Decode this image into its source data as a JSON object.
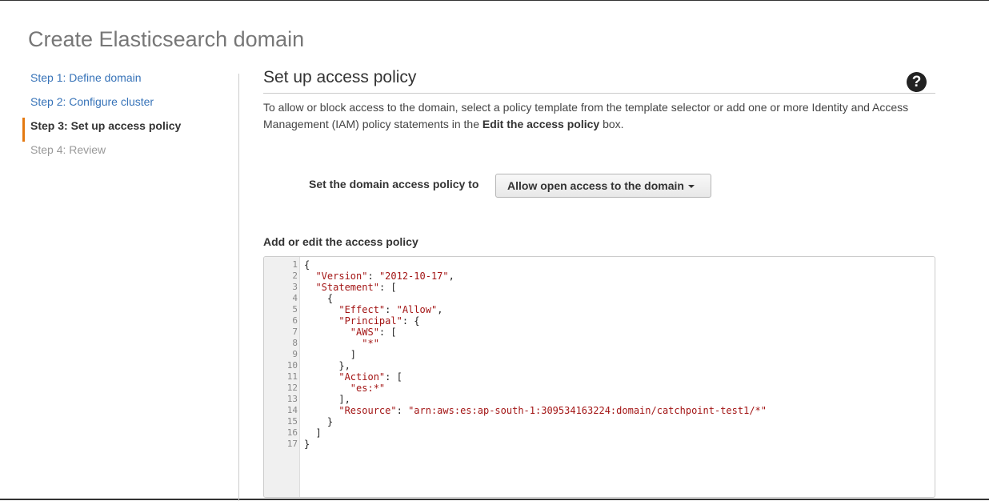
{
  "page_title": "Create Elasticsearch domain",
  "steps": [
    {
      "label": "Step 1: Define domain",
      "state": "link"
    },
    {
      "label": "Step 2: Configure cluster",
      "state": "link"
    },
    {
      "label": "Step 3: Set up access policy",
      "state": "active"
    },
    {
      "label": "Step 4: Review",
      "state": "disabled"
    }
  ],
  "section": {
    "title": "Set up access policy",
    "help_icon": "question-circle-icon",
    "description_part1": "To allow or block access to the domain, select a policy template from the template selector or add one or more Identity and Access Management (IAM) policy statements in the ",
    "description_bold": "Edit the access policy",
    "description_part2": " box."
  },
  "policy_selector": {
    "label": "Set the domain access policy to",
    "value": "Allow open access to the domain"
  },
  "editor": {
    "label": "Add or edit the access policy",
    "lines": [
      "{",
      "  \"Version\": \"2012-10-17\",",
      "  \"Statement\": [",
      "    {",
      "      \"Effect\": \"Allow\",",
      "      \"Principal\": {",
      "        \"AWS\": [",
      "          \"*\"",
      "        ]",
      "      },",
      "      \"Action\": [",
      "        \"es:*\"",
      "      ],",
      "      \"Resource\": \"arn:aws:es:ap-south-1:309534163224:domain/catchpoint-test1/*\"",
      "    }",
      "  ]",
      "}"
    ]
  },
  "colors": {
    "link": "#3773b8",
    "active_marker": "#e47911",
    "json_string": "#a31515"
  }
}
